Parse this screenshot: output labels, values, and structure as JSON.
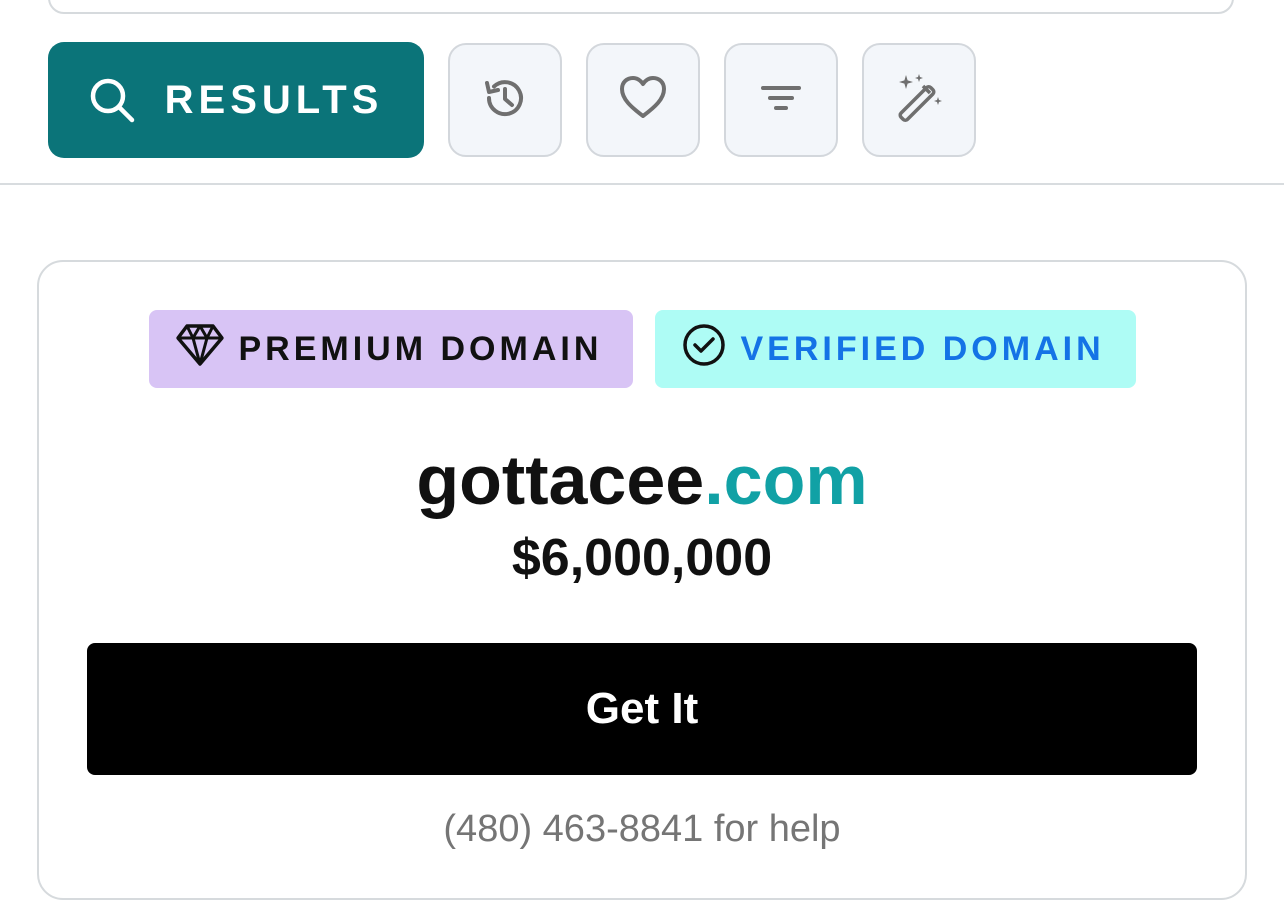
{
  "toolbar": {
    "results_label": "RESULTS",
    "results_icon": "search-icon",
    "icon_buttons": [
      {
        "icon": "history-icon"
      },
      {
        "icon": "heart-icon"
      },
      {
        "icon": "filter-icon"
      },
      {
        "icon": "magic-wand-icon"
      }
    ]
  },
  "card": {
    "badges": {
      "premium": {
        "label": "PREMIUM DOMAIN",
        "icon": "diamond-icon"
      },
      "verified": {
        "label": "VERIFIED DOMAIN",
        "icon": "check-circle-icon"
      }
    },
    "domain": {
      "name": "gottacee",
      "tld": ".com"
    },
    "price": "$6,000,000",
    "cta_label": "Get It",
    "help": {
      "phone": "(480) 463-8841",
      "suffix": " for help"
    }
  },
  "colors": {
    "results_button": "#0b7479",
    "tld": "#11a1a5",
    "premium_badge": "#d8c4f5",
    "verified_badge": "#aefcf5",
    "verified_text": "#1473e6",
    "cta": "#000000"
  }
}
